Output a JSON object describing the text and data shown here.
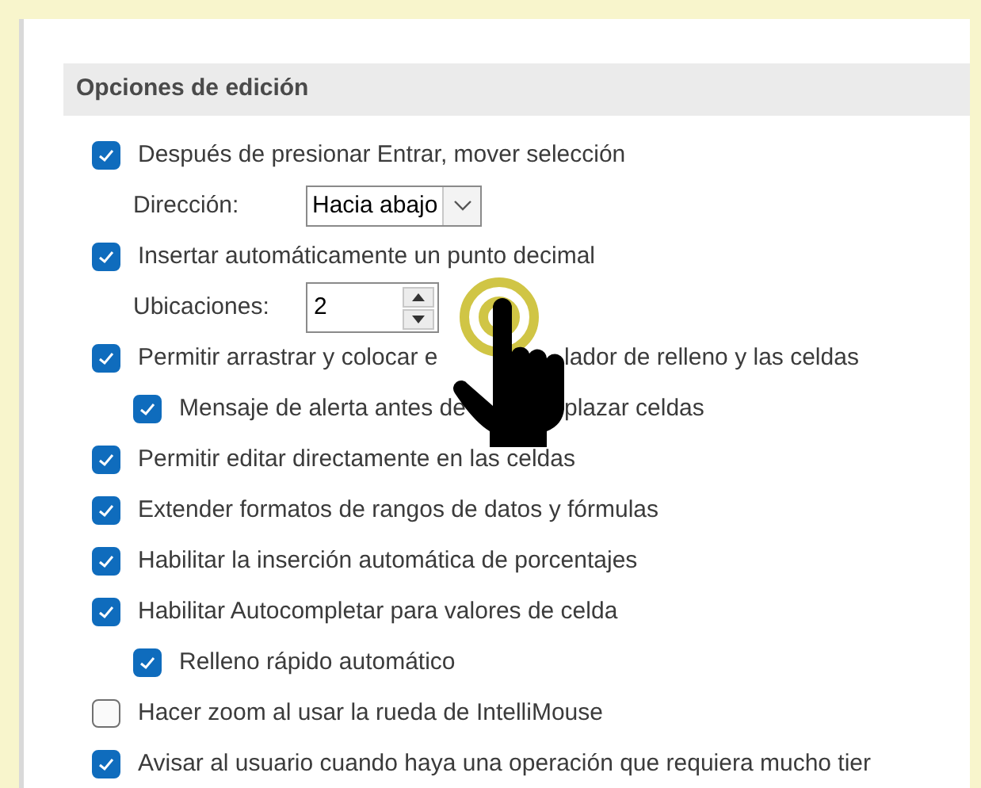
{
  "section": {
    "title": "Opciones de edición"
  },
  "options": [
    {
      "kind": "checkbox",
      "checked": true,
      "label": "Después de presionar Entrar, mover selección",
      "children": [
        {
          "kind": "dropdown",
          "label": "Dirección:",
          "value": "Hacia abajo"
        }
      ]
    },
    {
      "kind": "checkbox",
      "checked": true,
      "label": "Insertar automáticamente un punto decimal",
      "children": [
        {
          "kind": "spinner",
          "label": "Ubicaciones:",
          "value": "2"
        }
      ]
    },
    {
      "kind": "checkbox",
      "checked": true,
      "label_parts": [
        "Permitir arrastrar y colocar e",
        "lador de relleno y las celdas"
      ],
      "children": [
        {
          "kind": "checkbox",
          "checked": true,
          "label_parts": [
            "Mensaje de alerta antes de",
            "plazar celdas"
          ]
        }
      ]
    },
    {
      "kind": "checkbox",
      "checked": true,
      "label": "Permitir editar directamente en las celdas"
    },
    {
      "kind": "checkbox",
      "checked": true,
      "label": "Extender formatos de rangos de datos y fórmulas"
    },
    {
      "kind": "checkbox",
      "checked": true,
      "label": "Habilitar la inserción automática de porcentajes"
    },
    {
      "kind": "checkbox",
      "checked": true,
      "label": "Habilitar Autocompletar para valores de celda",
      "children": [
        {
          "kind": "checkbox",
          "checked": true,
          "label": "Relleno rápido automático"
        }
      ]
    },
    {
      "kind": "checkbox",
      "checked": false,
      "label": "Hacer zoom al usar la rueda de IntelliMouse"
    },
    {
      "kind": "checkbox",
      "checked": true,
      "label": "Avisar al usuario cuando haya una operación que requiera mucho tier"
    }
  ]
}
